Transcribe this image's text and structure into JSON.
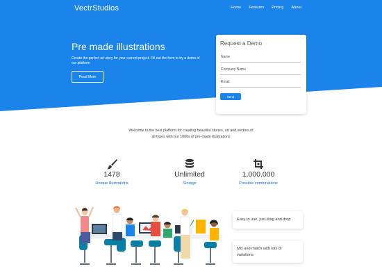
{
  "colors": {
    "primary": "#1a84ea",
    "accent_text": "#1a6fc9"
  },
  "header": {
    "brand": "VectrStudios",
    "nav": [
      {
        "label": "Home"
      },
      {
        "label": "Features"
      },
      {
        "label": "Pricing"
      },
      {
        "label": "About"
      }
    ]
  },
  "hero": {
    "title": "Pre made illustrations",
    "subtitle": "Create the perfect art story for your current project. Fill out the form to try a demo of our platform",
    "read_more_label": "Read More"
  },
  "demo_form": {
    "title": "Request a Demo",
    "fields": [
      {
        "label": "Name",
        "value": ""
      },
      {
        "label": "Company Name",
        "value": ""
      },
      {
        "label": "Email",
        "value": ""
      }
    ],
    "send_label": "Send"
  },
  "welcome_text": "Welcome to the best platform for creating beautiful stories, art and vectors of all types with our 1000s of pre-made illustrations",
  "stats": [
    {
      "icon": "brush-icon",
      "value": "1478",
      "label": "Unique illustrations"
    },
    {
      "icon": "database-icon",
      "value": "Unlimited",
      "label": "Storage"
    },
    {
      "icon": "crop-icon",
      "value": "1,000,000",
      "label": "Possible combinations"
    }
  ],
  "features": [
    {
      "text": "Easy to use, just drag and drop"
    },
    {
      "text": "Mix and match with lots of variations"
    }
  ]
}
